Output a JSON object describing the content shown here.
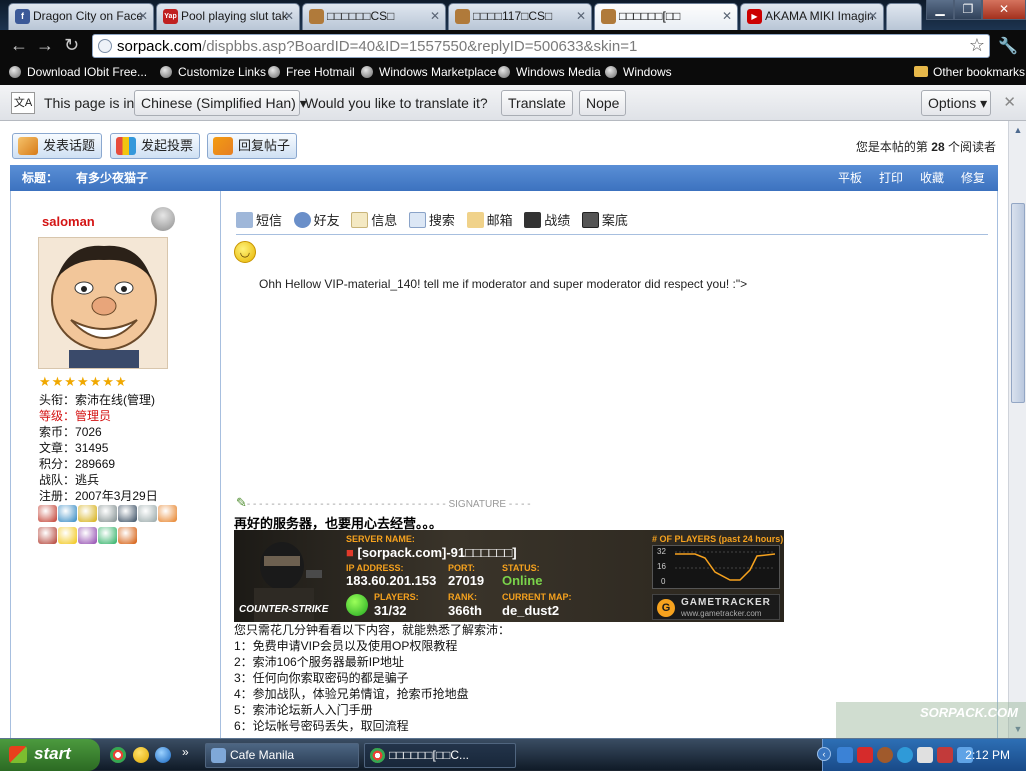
{
  "browser": {
    "tabs": [
      {
        "title": "Dragon City on Face",
        "fav_color": "#3b5998",
        "fav_text": "f"
      },
      {
        "title": "Pool playing slut tak",
        "fav_color": "#c02020",
        "fav_text": "Yap"
      },
      {
        "title": "□□□□□□CS□",
        "fav_color": "#b07a3a",
        "fav_text": ""
      },
      {
        "title": "□□□□117□CS□",
        "fav_color": "#b07a3a",
        "fav_text": ""
      },
      {
        "title": "□□□□□□[□□",
        "fav_color": "#b07a3a",
        "fav_text": ""
      },
      {
        "title": "AKAMA MIKI Imagin",
        "fav_color": "#cc0000",
        "fav_text": "▶"
      }
    ],
    "url_domain": "sorpack.com",
    "url_path": "/dispbbs.asp?BoardID=40&ID=1557550&replyID=500633&skin=1",
    "bookmarks": [
      "Download IObit Free...",
      "Customize Links",
      "Free Hotmail",
      "Windows Marketplace",
      "Windows Media",
      "Windows"
    ],
    "other_bookmarks": "Other bookmarks"
  },
  "translate": {
    "prefix": "This page is in",
    "language": "Chinese (Simplified Han)",
    "question": "Would you like to translate it?",
    "translate_label": "Translate",
    "nope_label": "Nope",
    "options_label": "Options"
  },
  "forum": {
    "buttons": [
      "发表话题",
      "发起投票",
      "回复帖子"
    ],
    "readers_prefix": "您是本帖的第",
    "readers_count": "28",
    "readers_suffix": "个阅读者",
    "title_label": "标题：",
    "title_text": "有多少夜猫子",
    "title_actions": [
      "平板",
      "打印",
      "收藏",
      "修复"
    ],
    "user": {
      "name": "saloman",
      "stars": "★★★★★★★",
      "info": [
        {
          "label": "头衔：",
          "value": "索沛在线(管理)",
          "red": false
        },
        {
          "label": "等级：",
          "value": "管理员",
          "red": true
        },
        {
          "label": "索币：",
          "value": "7026",
          "red": false
        },
        {
          "label": "文章：",
          "value": "31495",
          "red": false
        },
        {
          "label": "积分：",
          "value": "289669",
          "red": false
        },
        {
          "label": "战队：",
          "value": "逃兵",
          "red": false
        },
        {
          "label": "注册：",
          "value": "2007年3月29日",
          "red": false
        }
      ],
      "medal_colors": [
        "#c0392b",
        "#2e86c1",
        "#d4ac0d",
        "#7f8c8d",
        "#34495e",
        "#95a5a6",
        "#e67e22",
        "#b03a2e",
        "#f1c40f",
        "#8e44ad",
        "#27ae60",
        "#d35400"
      ]
    },
    "tools": [
      "短信",
      "好友",
      "信息",
      "搜索",
      "邮箱",
      "战绩",
      "案底"
    ],
    "message": "Ohh Hellow VIP-material_140! tell me if moderator and super moderator did respect you! :\">",
    "signature_label": "SIGNATURE",
    "signature_heading": "再好的服务器，也要用心去经营。。。",
    "banner": {
      "server_name_label": "SERVER NAME:",
      "server_name": "[sorpack.com]-91□□□□□□]",
      "ip_label": "IP ADDRESS:",
      "ip": "183.60.201.153",
      "port_label": "PORT:",
      "port": "27019",
      "status_label": "STATUS:",
      "status": "Online",
      "players_label": "PLAYERS:",
      "players": "31/32",
      "rank_label": "RANK:",
      "rank": "366th",
      "map_label": "CURRENT MAP:",
      "map": "de_dust2",
      "graph_label": "# OF PLAYERS (past 24 hours)",
      "graph_ticks": [
        "32",
        "16",
        "0"
      ],
      "game_logo": "COUNTER-STRIKE",
      "tracker": "GAMETRACKER",
      "tracker_url": "www.gametracker.com"
    },
    "list_intro": "您只需花几分钟看看以下内容，就能熟悉了解索沛：",
    "list": [
      "1：免费申请VIP会员以及使用OP权限教程",
      "2：索沛106个服务器最新IP地址",
      "3：任何向你索取密码的都是骗子",
      "4：参加战队，体验兄弟情谊，抢索币抢地盘",
      "5：索沛论坛新人入门手册",
      "6：论坛帐号密码丢失，取回流程"
    ],
    "watermark": "SORPACK.COM"
  },
  "taskbar": {
    "start_label": "start",
    "tasks": [
      "Cafe Manila",
      "□□□□□□[□□C..."
    ],
    "clock": "2:12 PM"
  }
}
